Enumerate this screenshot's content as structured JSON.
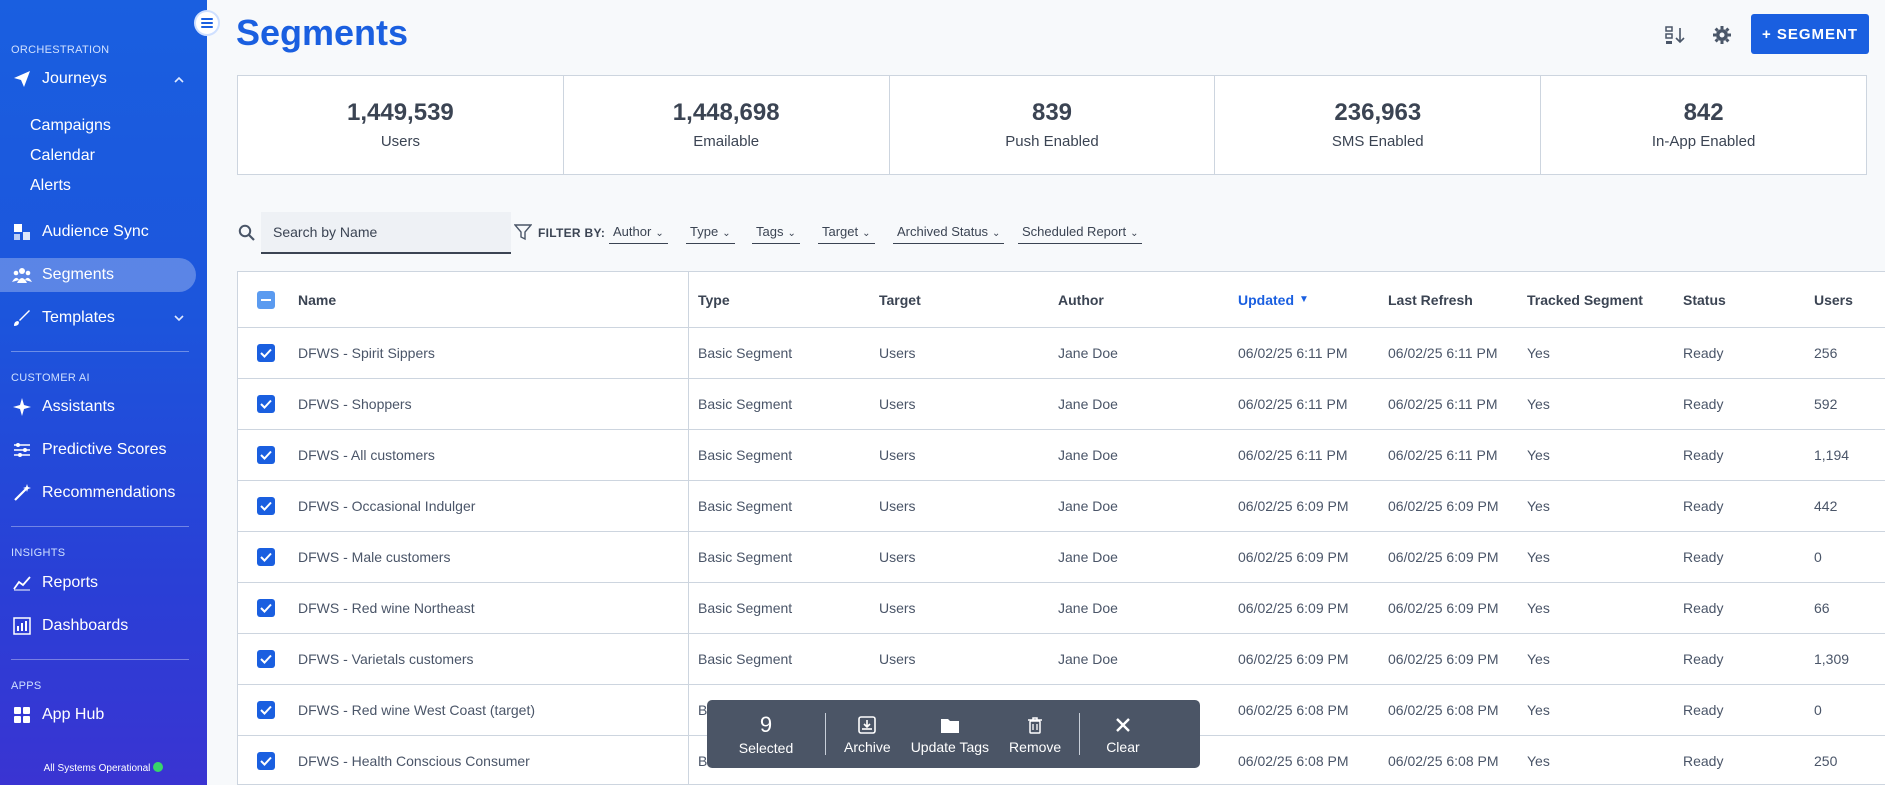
{
  "sidebar": {
    "sections": {
      "orchestration": "ORCHESTRATION",
      "customer_ai": "CUSTOMER AI",
      "insights": "INSIGHTS",
      "apps": "APPS"
    },
    "journeys": "Journeys",
    "sub_items": [
      "Campaigns",
      "Calendar",
      "Alerts"
    ],
    "audience_sync": "Audience Sync",
    "segments": "Segments",
    "templates": "Templates",
    "assistants": "Assistants",
    "predictive_scores": "Predictive Scores",
    "recommendations": "Recommendations",
    "reports": "Reports",
    "dashboards": "Dashboards",
    "app_hub": "App Hub",
    "status": "All Systems Operational"
  },
  "header": {
    "title": "Segments",
    "add_button": "+ SEGMENT"
  },
  "stats": [
    {
      "value": "1,449,539",
      "label": "Users"
    },
    {
      "value": "1,448,698",
      "label": "Emailable"
    },
    {
      "value": "839",
      "label": "Push Enabled"
    },
    {
      "value": "236,963",
      "label": "SMS Enabled"
    },
    {
      "value": "842",
      "label": "In-App Enabled"
    }
  ],
  "filters": {
    "search_placeholder": "Search by Name",
    "filter_by": "FILTER BY:",
    "dropdowns": [
      "Author",
      "Type",
      "Tags",
      "Target",
      "Archived Status",
      "Scheduled Report"
    ]
  },
  "table": {
    "columns": [
      "Name",
      "Type",
      "Target",
      "Author",
      "Updated",
      "Last Refresh",
      "Tracked Segment",
      "Status",
      "Users"
    ],
    "rows": [
      [
        "DFWS - Spirit Sippers",
        "Basic Segment",
        "Users",
        "Jane Doe",
        "06/02/25 6:11 PM",
        "06/02/25 6:11 PM",
        "Yes",
        "Ready",
        "256"
      ],
      [
        "DFWS - Shoppers",
        "Basic Segment",
        "Users",
        "Jane Doe",
        "06/02/25 6:11 PM",
        "06/02/25 6:11 PM",
        "Yes",
        "Ready",
        "592"
      ],
      [
        "DFWS - All customers",
        "Basic Segment",
        "Users",
        "Jane Doe",
        "06/02/25 6:11 PM",
        "06/02/25 6:11 PM",
        "Yes",
        "Ready",
        "1,194"
      ],
      [
        "DFWS - Occasional Indulger",
        "Basic Segment",
        "Users",
        "Jane Doe",
        "06/02/25 6:09 PM",
        "06/02/25 6:09 PM",
        "Yes",
        "Ready",
        "442"
      ],
      [
        "DFWS - Male customers",
        "Basic Segment",
        "Users",
        "Jane Doe",
        "06/02/25 6:09 PM",
        "06/02/25 6:09 PM",
        "Yes",
        "Ready",
        "0"
      ],
      [
        "DFWS - Red wine Northeast",
        "Basic Segment",
        "Users",
        "Jane Doe",
        "06/02/25 6:09 PM",
        "06/02/25 6:09 PM",
        "Yes",
        "Ready",
        "66"
      ],
      [
        "DFWS - Varietals customers",
        "Basic Segment",
        "Users",
        "Jane Doe",
        "06/02/25 6:09 PM",
        "06/02/25 6:09 PM",
        "Yes",
        "Ready",
        "1,309"
      ],
      [
        "DFWS - Red wine West Coast (target)",
        "B",
        "",
        "",
        "06/02/25 6:08 PM",
        "06/02/25 6:08 PM",
        "Yes",
        "Ready",
        "0"
      ],
      [
        "DFWS - Health Conscious Consumer",
        "B",
        "",
        "",
        "06/02/25 6:08 PM",
        "06/02/25 6:08 PM",
        "Yes",
        "Ready",
        "250"
      ]
    ]
  },
  "selection_bar": {
    "count": "9",
    "count_label": "Selected",
    "archive": "Archive",
    "update_tags": "Update Tags",
    "remove": "Remove",
    "clear": "Clear"
  },
  "colors": {
    "accent": "#1a5fe0",
    "status_ok": "#38d46a"
  }
}
